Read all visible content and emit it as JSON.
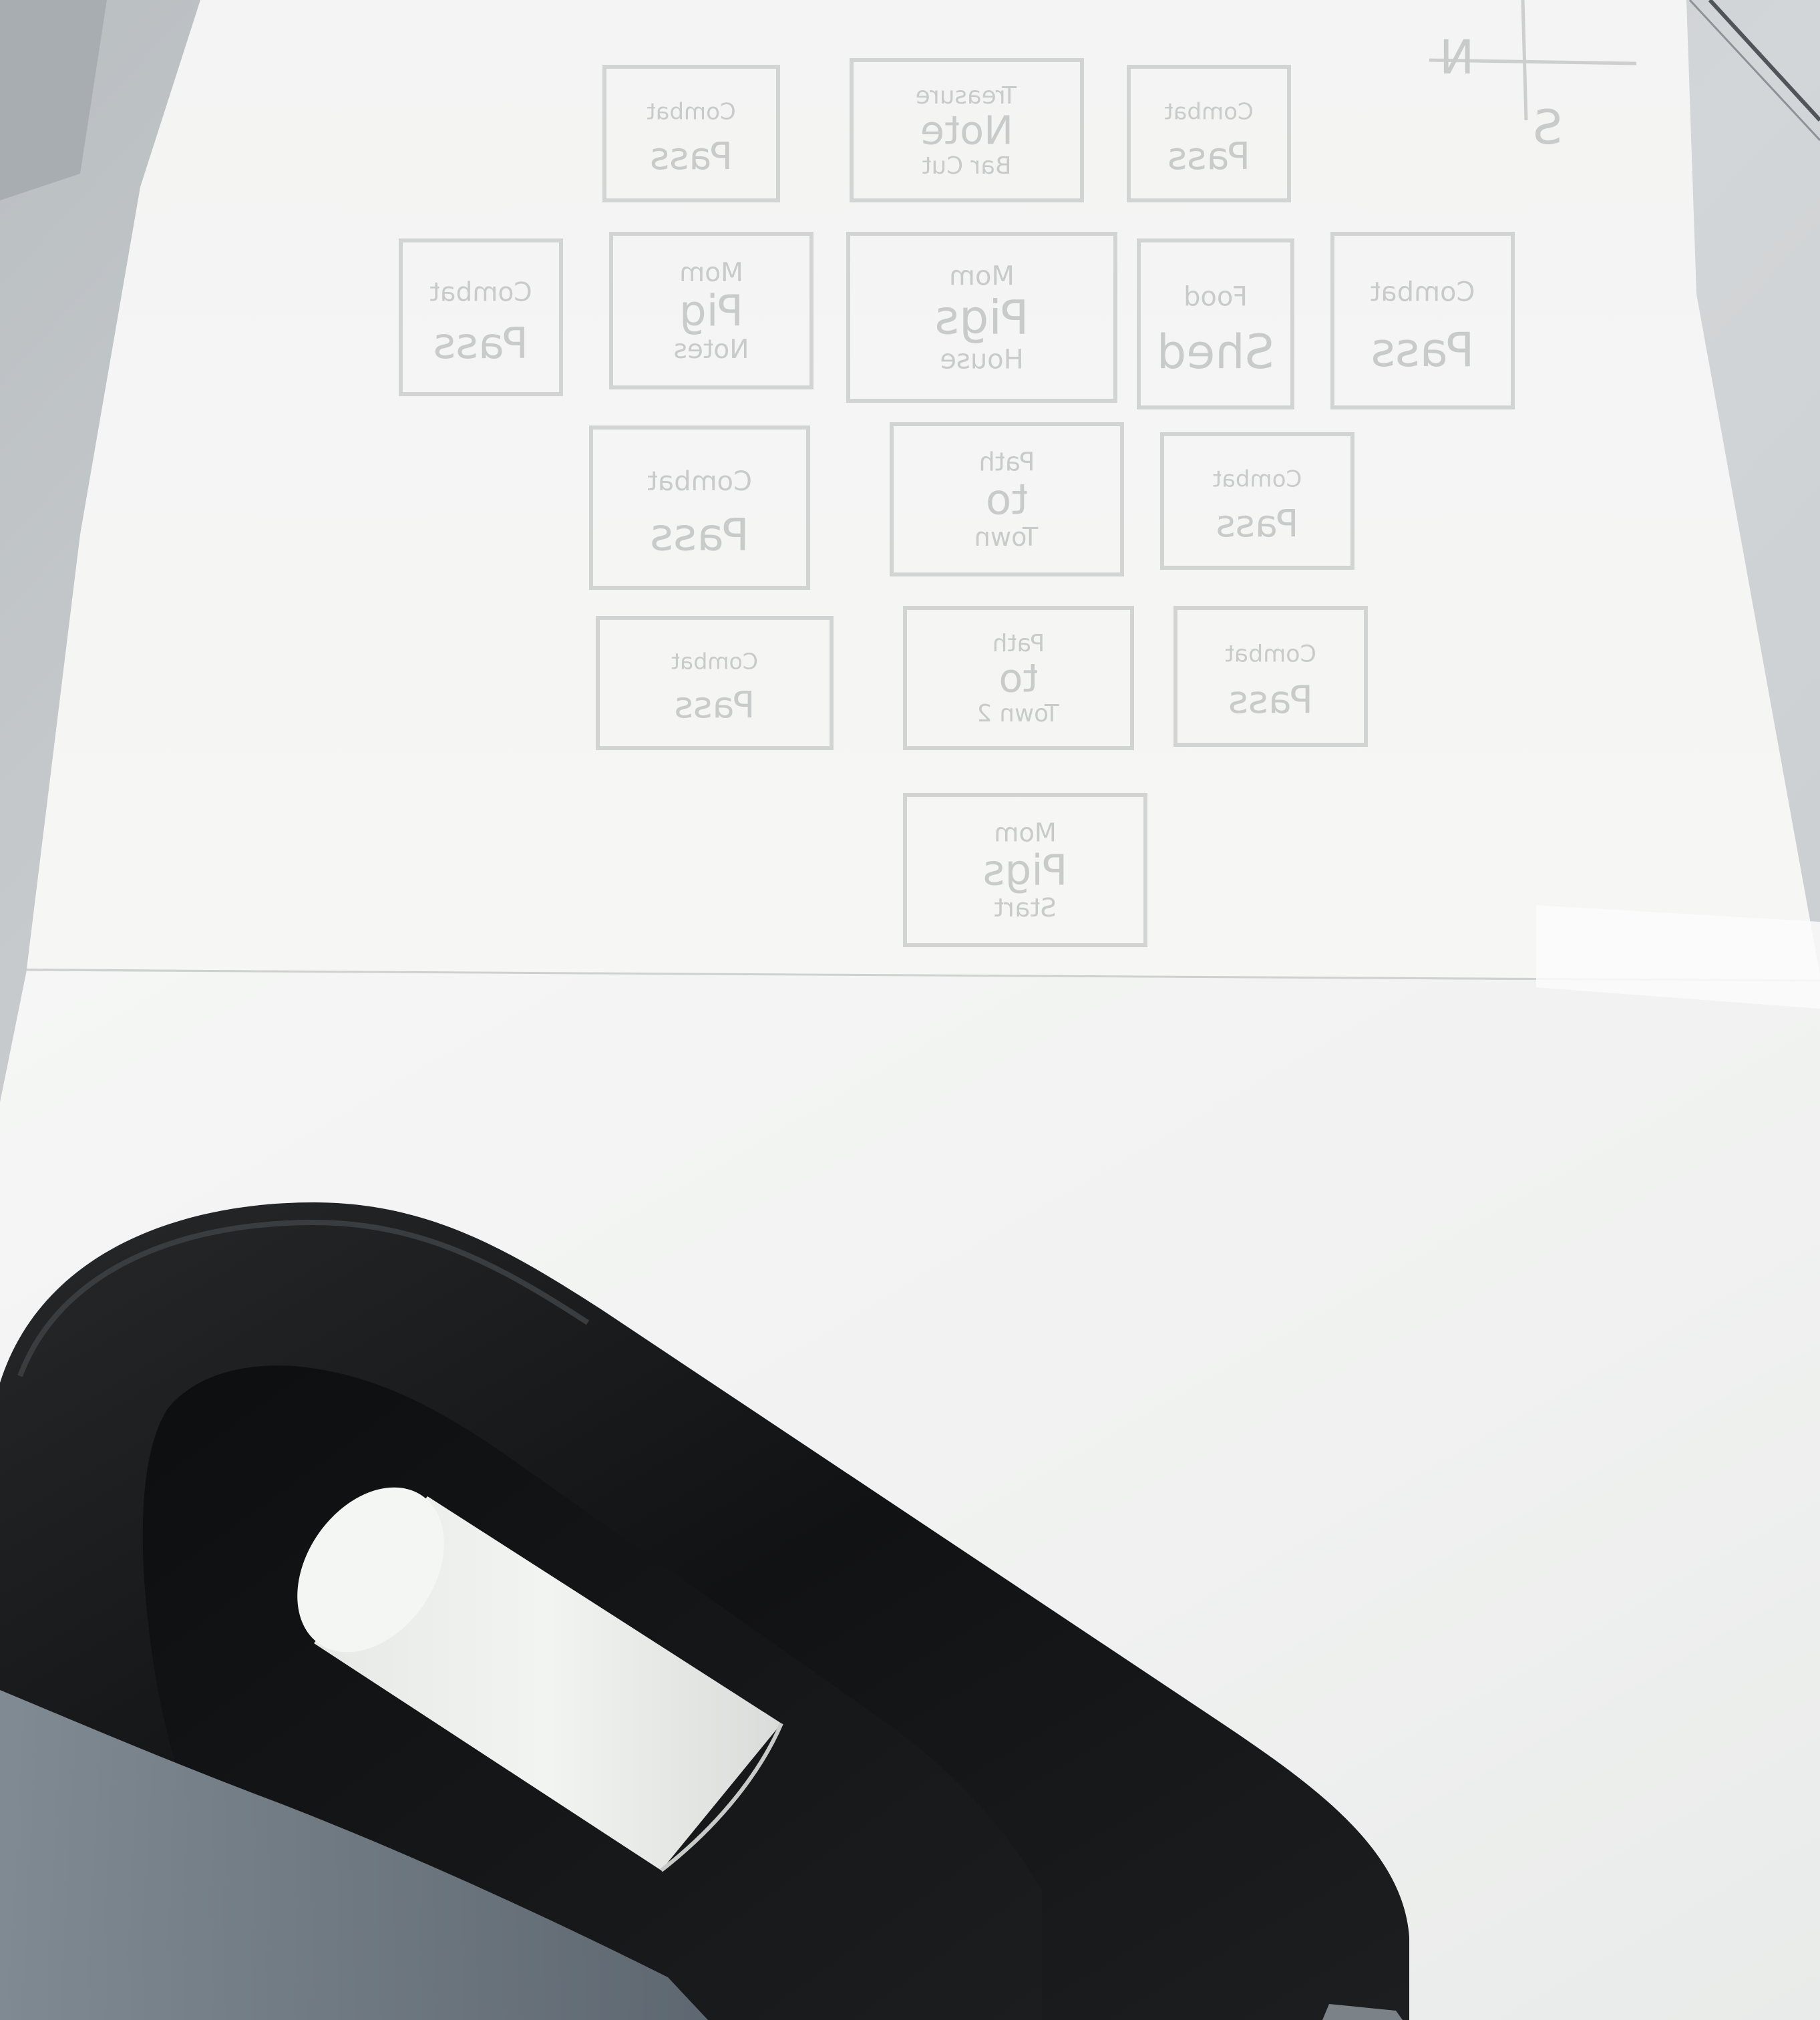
{
  "scene": {
    "description_tags": [
      "photo",
      "paper-sheet",
      "tape-dispenser",
      "see-through-sketch"
    ],
    "colors": {
      "desk": "#cfd3d5",
      "paper": "#f4f5f4",
      "paper_lower": "#f1f2f1",
      "pencil_ghost": "#cfd0cf",
      "dispenser": "#141516",
      "tape_roll": "#eceeec"
    }
  },
  "sketch": {
    "rooms": [
      {
        "lines": [
          "Combat",
          "Pass"
        ]
      },
      {
        "lines": [
          "Treasure",
          "Note",
          "Bar Cut"
        ]
      },
      {
        "lines": [
          "Combat",
          "Pass"
        ]
      },
      {
        "lines": [
          "Combat",
          "Pass"
        ]
      },
      {
        "lines": [
          "Mom",
          "Pig",
          "Notes"
        ]
      },
      {
        "lines": [
          "Mom",
          "Pigs",
          "House"
        ]
      },
      {
        "lines": [
          "Food",
          "Shed"
        ]
      },
      {
        "lines": [
          "Combat",
          "Pass"
        ]
      },
      {
        "lines": [
          "Combat",
          "Pass"
        ]
      },
      {
        "lines": [
          "Path",
          "to",
          "Town"
        ]
      },
      {
        "lines": [
          "Combat",
          "Pass"
        ]
      },
      {
        "lines": [
          "Combat",
          "Pass"
        ]
      },
      {
        "lines": [
          "Path",
          "to",
          "Town 2"
        ]
      },
      {
        "lines": [
          "Combat",
          "Pass"
        ]
      },
      {
        "lines": [
          "Mom",
          "Pigs",
          "Start"
        ]
      }
    ],
    "compass": {
      "north": "N",
      "south": "S"
    }
  }
}
